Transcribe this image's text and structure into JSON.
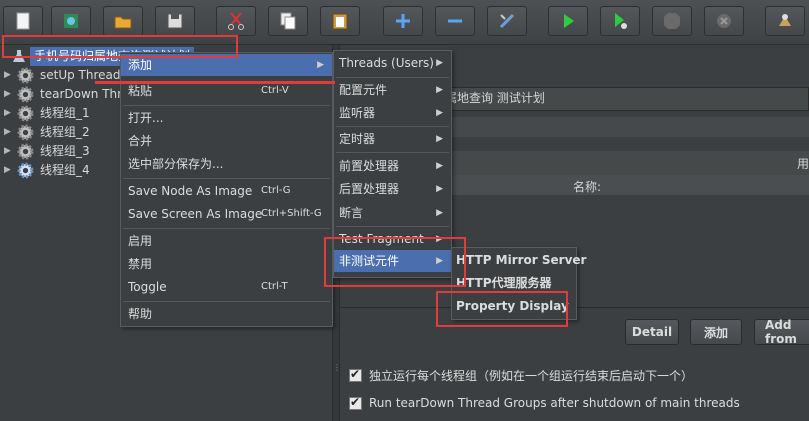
{
  "toolbar": {
    "buttons": [
      {
        "icon": "new-file-icon"
      },
      {
        "icon": "templates-icon"
      },
      {
        "icon": "open-icon"
      },
      {
        "icon": "save-icon"
      },
      {
        "icon": "cut-icon"
      },
      {
        "icon": "copy-icon"
      },
      {
        "icon": "paste-icon"
      },
      {
        "icon": "expand-icon"
      },
      {
        "icon": "collapse-icon"
      },
      {
        "icon": "toggle-icon"
      },
      {
        "icon": "start-icon"
      },
      {
        "icon": "start-no-pauses-icon"
      },
      {
        "icon": "stop-icon"
      },
      {
        "icon": "shutdown-icon"
      },
      {
        "icon": "clear-icon"
      }
    ]
  },
  "tree": {
    "root_label": "手机号码归属地查询测试计划",
    "items": [
      {
        "label": "setUp Thread G"
      },
      {
        "label": "tearDown Thre"
      },
      {
        "label": "线程组_1"
      },
      {
        "label": "线程组_2"
      },
      {
        "label": "线程组_3"
      },
      {
        "label": "线程组_4"
      }
    ]
  },
  "right": {
    "name_value": "属地查询 测试计划",
    "col_use": "用",
    "col_name": "名称:",
    "detail": "Detail",
    "add": "添加",
    "add_from": "Add from",
    "check1": "独立运行每个线程组（例如在一个组运行结束后启动下一个）",
    "check2": "Run tearDown Thread Groups after shutdown of main threads"
  },
  "context_menu": {
    "add": "添加",
    "paste": "粘贴",
    "paste_key": "Ctrl-V",
    "open": "打开...",
    "merge": "合并",
    "save_selection": "选中部分保存为...",
    "save_node_image": "Save Node As Image",
    "save_node_key": "Ctrl-G",
    "save_screen_image": "Save Screen As Image",
    "save_screen_key": "Ctrl+Shift-G",
    "enable": "启用",
    "disable": "禁用",
    "toggle": "Toggle",
    "toggle_key": "Ctrl-T",
    "help": "帮助"
  },
  "add_menu": {
    "threads": "Threads (Users)",
    "config": "配置元件",
    "listener": "监听器",
    "timer": "定时器",
    "pre": "前置处理器",
    "post": "后置处理器",
    "assert": "断言",
    "fragment": "Test Fragment",
    "non_test": "非测试元件"
  },
  "non_test_menu": {
    "mirror": "HTTP Mirror Server",
    "proxy": "HTTP代理服务器",
    "property": "Property Display"
  },
  "colors": {
    "selection": "#4b6eaf",
    "highlight": "#e03c3c",
    "background": "#3c3f41"
  }
}
